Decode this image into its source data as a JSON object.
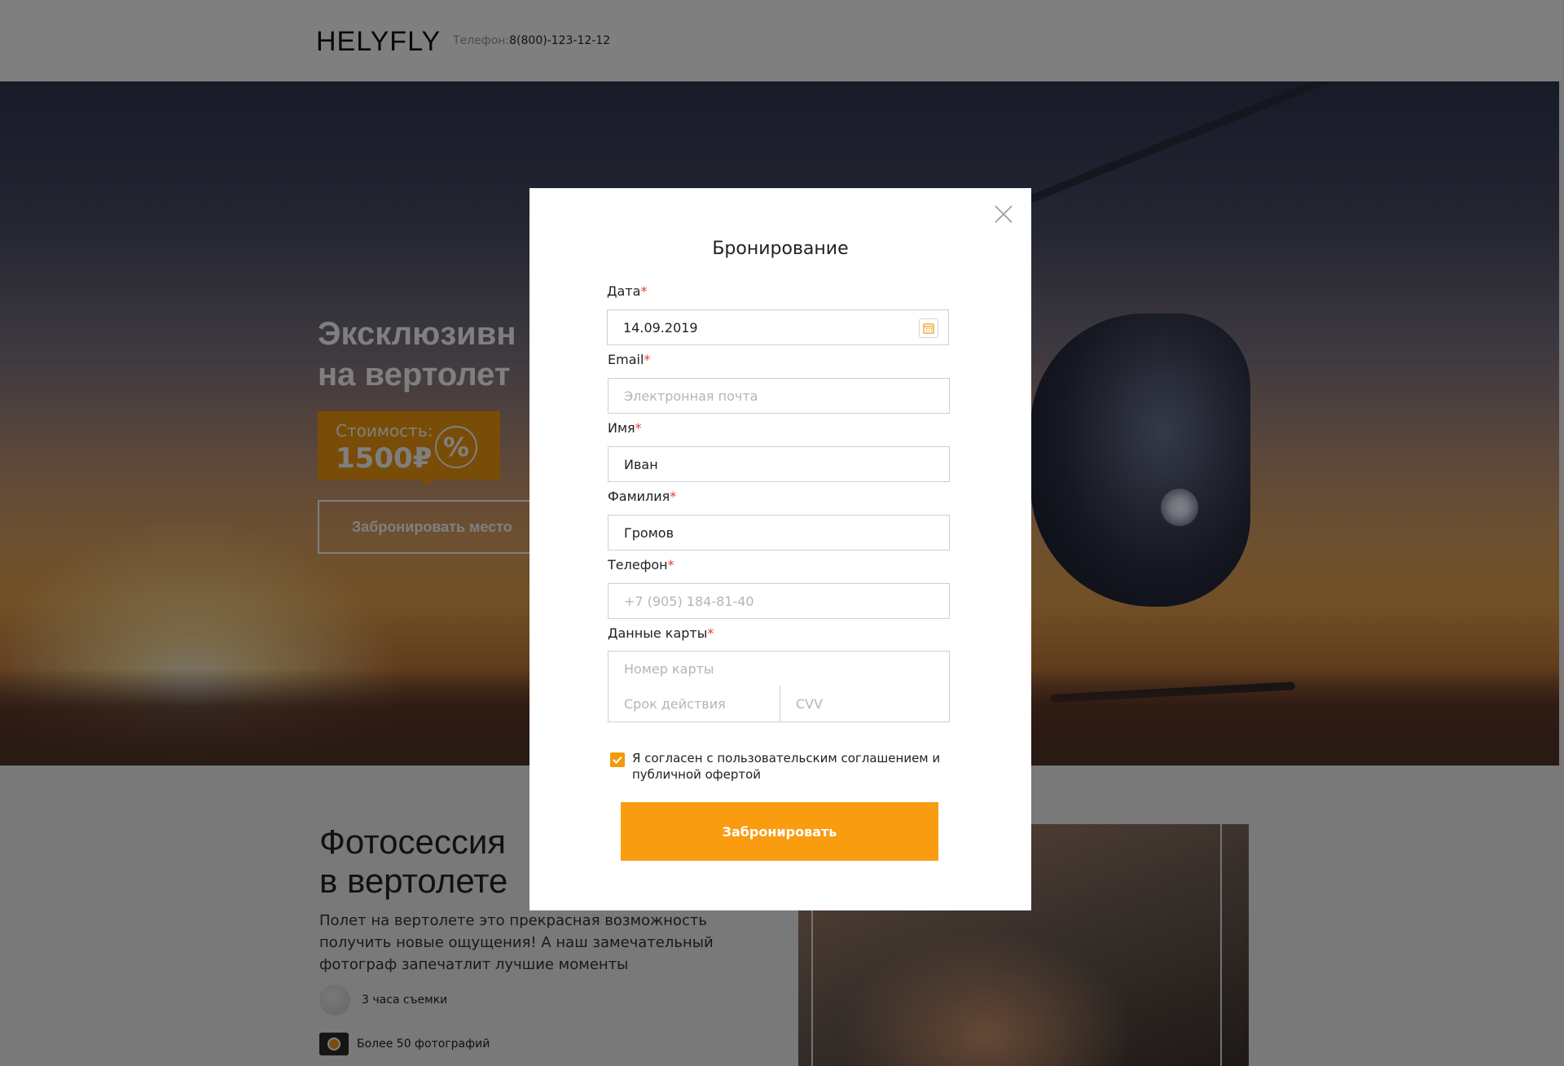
{
  "header": {
    "logo": "HELYFLY",
    "phone_label": "Телефон:",
    "phone_number": "8(800)-123-12-12"
  },
  "hero": {
    "title_line1": "Эксклюзивн",
    "title_line2": "на вертолет",
    "price_label": "Стоимость:",
    "price_value": "1500₽",
    "percent_symbol": "%",
    "book_place_label": "Забронировать место"
  },
  "section": {
    "title": "Фотосессия\nв вертолете",
    "description": "Полет на вертолете это прекрасная возможность получить новые ощущения! А наш замечательный фотограф запечатлит лучшие моменты",
    "features": [
      {
        "icon": "clock-icon",
        "text": "3 часа съемки"
      },
      {
        "icon": "camera-icon",
        "text": "Более 50 фотографий"
      }
    ]
  },
  "modal": {
    "title": "Бронирование",
    "fields": {
      "date": {
        "label": "Дата",
        "value": "14.09.2019",
        "placeholder": ""
      },
      "email": {
        "label": "Email",
        "value": "",
        "placeholder": "Электронная почта"
      },
      "name": {
        "label": "Имя",
        "value": "Иван",
        "placeholder": ""
      },
      "surname": {
        "label": "Фамилия",
        "value": "Громов",
        "placeholder": ""
      },
      "phone": {
        "label": "Телефон",
        "value": "",
        "placeholder": "+7 (905) 184-81-40"
      },
      "card": {
        "label": "Данные карты",
        "number_placeholder": "Номер карты",
        "expiry_placeholder": "Срок действия",
        "cvv_placeholder": "CVV"
      }
    },
    "required_mark": "*",
    "agreement": {
      "checked": true,
      "text": "Я согласен с пользовательским соглашением и публичной офертой"
    },
    "submit_label": "Забронировать"
  },
  "colors": {
    "accent": "#f99c10",
    "required": "#e23b3b",
    "overlay": "rgba(0,0,0,0.5)"
  }
}
